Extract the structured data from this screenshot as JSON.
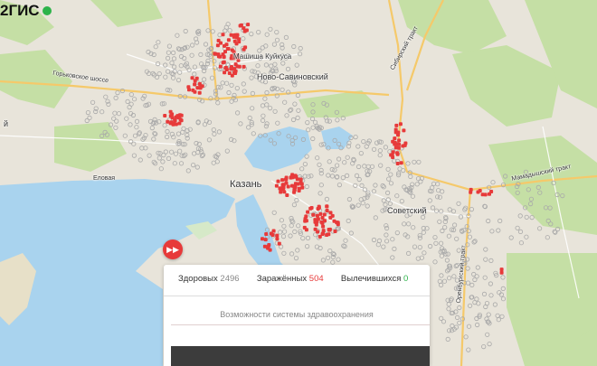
{
  "logo": {
    "text": "2ГИС"
  },
  "map_labels": [
    {
      "text": "Машиша Куйкуса",
      "size": 8
    },
    {
      "text": "Ново-Савиновский",
      "size": 9
    },
    {
      "text": "Горьковское шоссе",
      "size": 7
    },
    {
      "text": "Казань",
      "size": 11
    },
    {
      "text": "Советский",
      "size": 9
    },
    {
      "text": "Мамадышский тракт",
      "size": 7
    },
    {
      "text": "Оренбургский тракт",
      "size": 7
    },
    {
      "text": "Сибирский тракт",
      "size": 7
    },
    {
      "text": "Еловая",
      "size": 7
    },
    {
      "text": "й",
      "size": 9
    }
  ],
  "stats": {
    "healthy_label": "Здоровых",
    "healthy_value": "2496",
    "infected_label": "Заражённых",
    "infected_value": "504",
    "recovered_label": "Вылечившихся",
    "recovered_value": "0"
  },
  "caption": "Возможности системы здравоохранения",
  "colors": {
    "healthy": "#a9a9a9",
    "infected": "#e73a3a",
    "recovered": "#2db34a",
    "water": "#a9d3ee",
    "forest": "#c5dfa5",
    "urban": "#e8e4da"
  },
  "play_button": {
    "icon": "fast-forward-icon"
  }
}
